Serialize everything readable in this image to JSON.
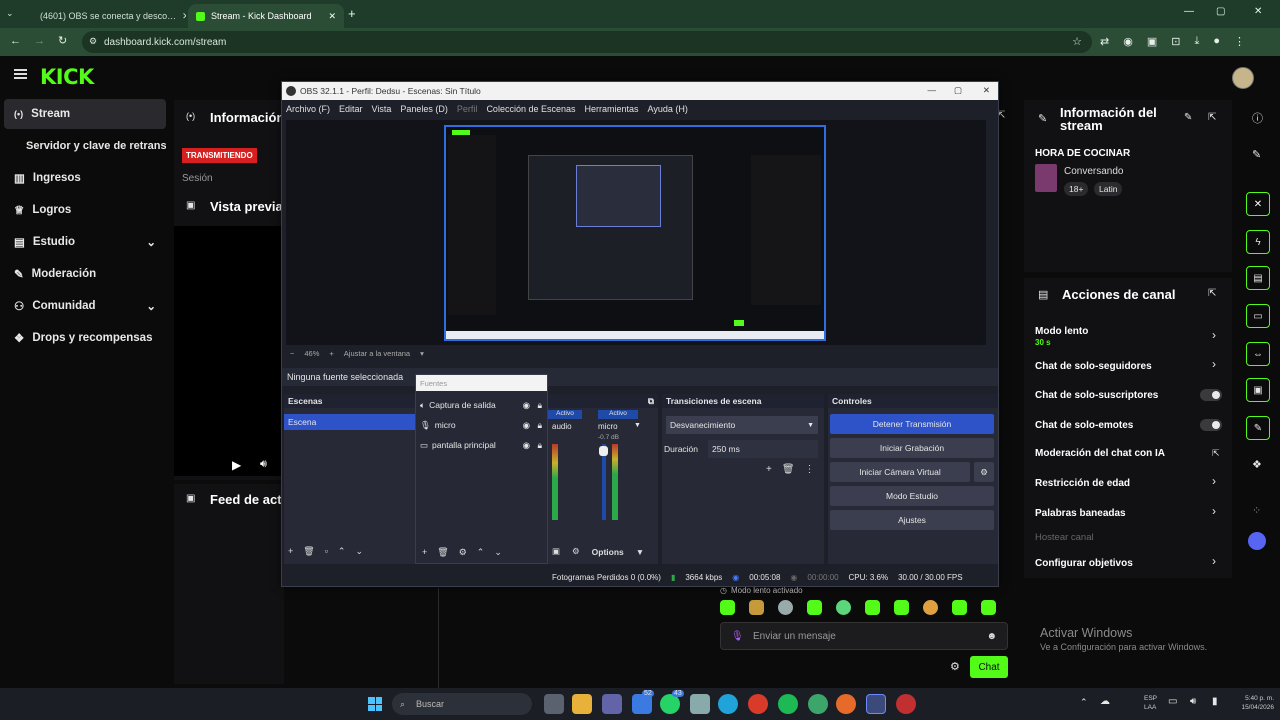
{
  "browser": {
    "tabs": [
      {
        "title": "(4601) OBS se conecta y desco…",
        "active": false
      },
      {
        "title": "Stream - Kick Dashboard",
        "active": true
      }
    ],
    "url": "dashboard.kick.com/stream"
  },
  "kick": {
    "logo": "KICK",
    "nav": [
      {
        "label": "Stream",
        "active": true
      },
      {
        "label": "Servidor y clave de retransm…",
        "active": false
      },
      {
        "label": "Ingresos"
      },
      {
        "label": "Logros"
      },
      {
        "label": "Estudio"
      },
      {
        "label": "Moderación"
      },
      {
        "label": "Comunidad"
      },
      {
        "label": "Drops y recompensas"
      }
    ],
    "info_title": "Información",
    "status_badge": "TRANSMITIENDO",
    "session_label": "Sesión",
    "preview_title": "Vista previa",
    "feed_title": "Feed de acti…"
  },
  "obs": {
    "title": "OBS 32.1.1 - Perfil: Dedsu - Escenas: Sin Título",
    "menu": [
      "Archivo (F)",
      "Editar",
      "Vista",
      "Paneles (D)",
      "Perfil",
      "Colección de Escenas",
      "Herramientas",
      "Ayuda (H)"
    ],
    "zoom": "46%",
    "fit_label": "Ajustar a la ventana",
    "no_source": "Ninguna fuente seleccionada",
    "sources_header": "Fuentes",
    "scenes_header": "Escenas",
    "scenes": [
      "Escena"
    ],
    "sources": [
      "Captura de salida",
      "micro",
      "pantalla principal"
    ],
    "mixer": {
      "ch1": "audio",
      "ch2": "micro",
      "active": "Activo",
      "db": "-0.7 dB"
    },
    "transitions": {
      "header": "Transiciones de escena",
      "type": "Desvanecimiento",
      "duration_label": "Duración",
      "duration": "250 ms"
    },
    "controls": {
      "header": "Controles",
      "buttons": [
        "Detener Transmisión",
        "Iniciar Grabación",
        "Iniciar Cámara Virtual",
        "Modo Estudio",
        "Ajustes"
      ]
    },
    "options": "Options",
    "status": {
      "dropped": "Fotogramas Perdidos 0 (0.0%)",
      "bitrate": "3664 kbps",
      "live_time": "00:05:08",
      "rec_time": "00:00:00",
      "cpu": "CPU: 3.6%",
      "fps": "30.00 / 30.00 FPS"
    }
  },
  "stream_info": {
    "title": "Información del stream",
    "stream_title": "HORA DE COCINAR",
    "category": "Conversando",
    "tags": [
      "18+",
      "Latin"
    ]
  },
  "channel_actions": {
    "title": "Acciones de canal",
    "slow_mode": "Modo lento",
    "slow_value": "30 s",
    "items": [
      "Chat de solo-seguidores",
      "Chat de solo-suscriptores",
      "Chat de solo-emotes",
      "Moderación del chat con IA",
      "Restricción de edad",
      "Palabras baneadas",
      "Hostear canal",
      "Configurar objetivos"
    ]
  },
  "chat": {
    "slow_notice": "Modo lento activado",
    "placeholder": "Enviar un mensaje",
    "send": "Chat"
  },
  "watermark": {
    "line1": "Activar Windows",
    "line2": "Ve a Configuración para activar Windows."
  },
  "taskbar": {
    "search": "Buscar",
    "lang": "ESP",
    "lang2": "LAA",
    "time": "5:40 p. m.",
    "date": "15/04/2026",
    "badges": [
      "52",
      "43"
    ]
  }
}
